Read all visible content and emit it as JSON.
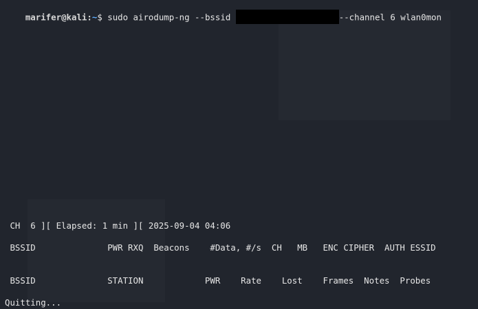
{
  "prompt": {
    "user": "marifer",
    "at": "@",
    "host": "kali",
    "colon": ":",
    "path": "~",
    "dollar": "$",
    "command_before": " sudo airodump-ng --bssid ",
    "command_after": "--channel 6 wlan0mon"
  },
  "status": {
    "line": " CH  6 ][ Elapsed: 1 min ][ 2025-09-04 04:06"
  },
  "ap_table": {
    "header": " BSSID              PWR RXQ  Beacons    #Data, #/s  CH   MB   ENC CIPHER  AUTH ESSID"
  },
  "station_table": {
    "header": " BSSID              STATION            PWR    Rate    Lost    Frames  Notes  Probes"
  },
  "footer": {
    "text": "Quitting..."
  },
  "colors": {
    "background": "#21252d",
    "text": "#e6e6e6",
    "path": "#5fafff",
    "redaction": "#000000"
  }
}
